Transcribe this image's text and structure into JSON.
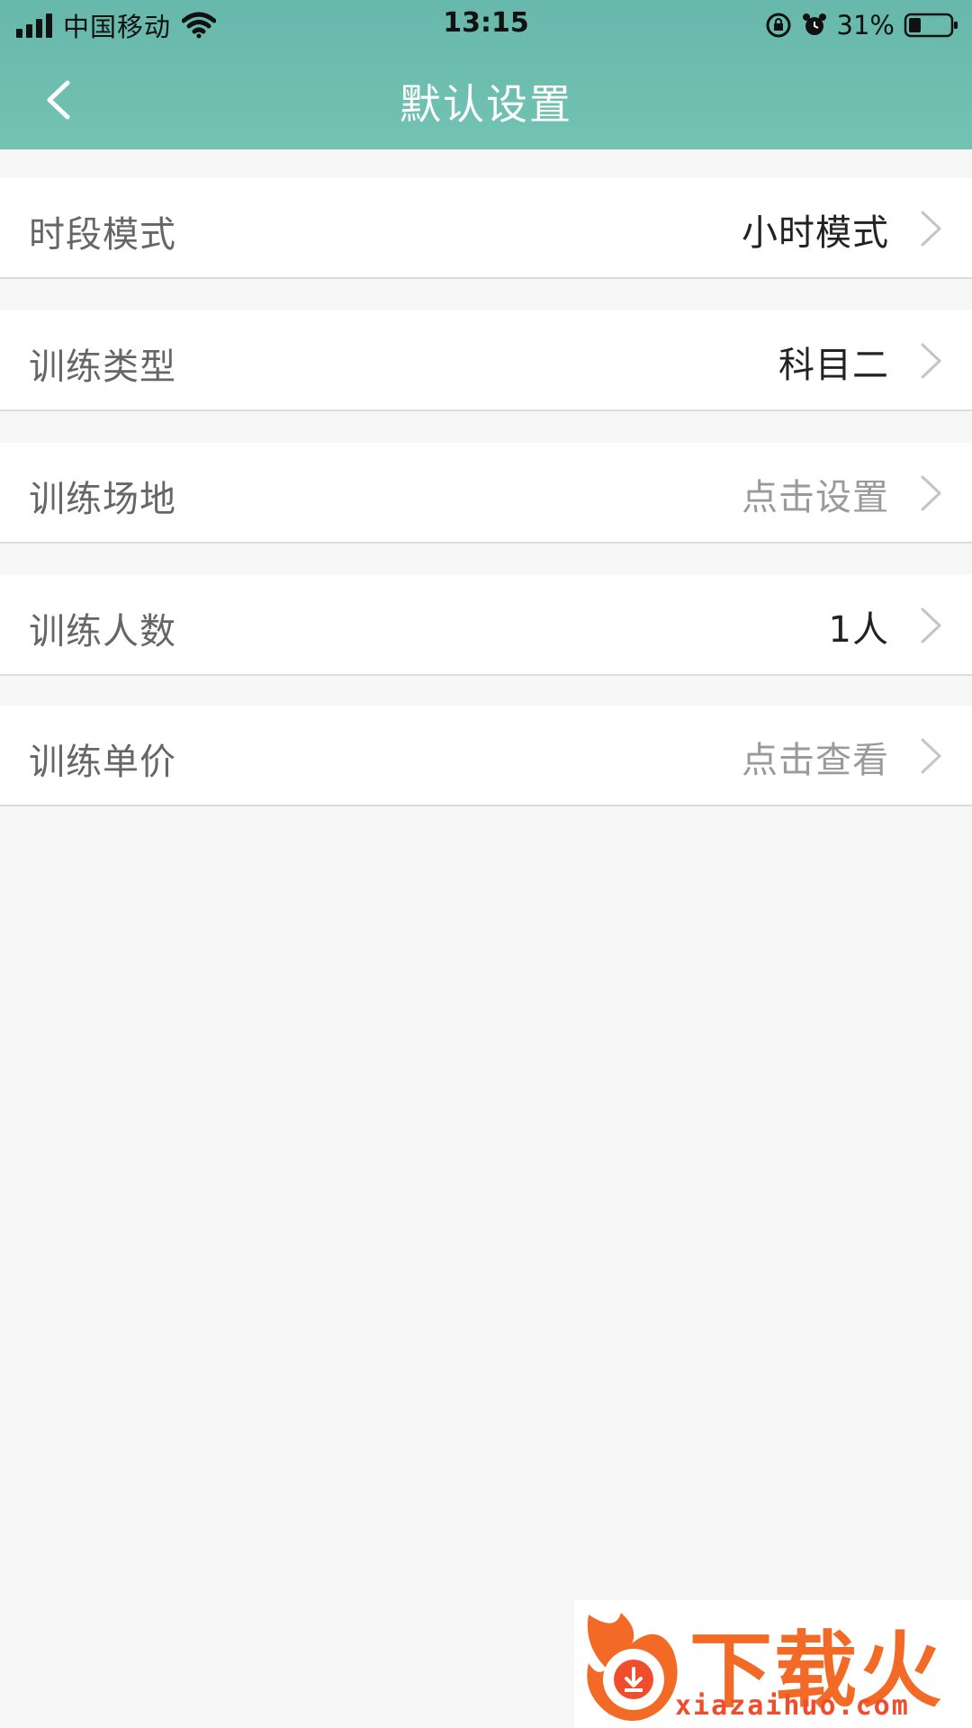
{
  "status_bar": {
    "carrier": "中国移动",
    "time": "13:15",
    "battery": "31%",
    "icons": [
      "signal-icon",
      "wifi-icon",
      "rotation-lock-icon",
      "alarm-icon",
      "battery-icon"
    ]
  },
  "nav": {
    "title": "默认设置",
    "back_icon": "chevron-left-icon"
  },
  "settings": [
    {
      "id": "time-mode",
      "label": "时段模式",
      "value": "小时模式",
      "value_style": "dark"
    },
    {
      "id": "training-type",
      "label": "训练类型",
      "value": "科目二",
      "value_style": "dark"
    },
    {
      "id": "training-venue",
      "label": "训练场地",
      "value": "点击设置",
      "value_style": "light"
    },
    {
      "id": "trainee-count",
      "label": "训练人数",
      "value": "1人",
      "value_style": "dark"
    },
    {
      "id": "unit-price",
      "label": "训练单价",
      "value": "点击查看",
      "value_style": "light"
    }
  ],
  "watermark": {
    "brand": "下载火",
    "url": "xiazaihuo.com"
  },
  "colors": {
    "header": "#6fbfaf",
    "background": "#f7f7f7",
    "label": "#666666",
    "value_dark": "#222222",
    "value_light": "#9a9a9a",
    "watermark": "#ef4d2b"
  }
}
